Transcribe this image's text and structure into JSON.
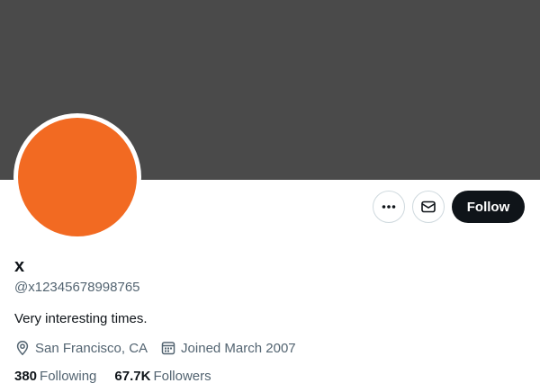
{
  "profile": {
    "display_name": "x",
    "handle": "@x12345678998765",
    "bio": "Very interesting times.",
    "location": "San Francisco, CA",
    "joined": "Joined March 2007",
    "following_count": "380",
    "following_label": "Following",
    "followers_count": "67.7K",
    "followers_label": "Followers"
  },
  "actions": {
    "follow_label": "Follow",
    "more_icon": "more-icon",
    "message_icon": "mail-icon"
  },
  "colors": {
    "banner": "#4a4a4a",
    "avatar": "#f26a22",
    "follow_button": "#0f1419",
    "secondary_text": "#536471"
  }
}
